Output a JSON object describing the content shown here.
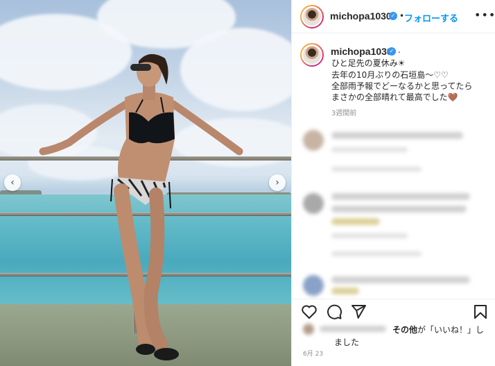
{
  "post": {
    "username": "michopa1030",
    "follow_label": "フォローする",
    "separator": "•",
    "more_label": "•••"
  },
  "caption": {
    "username": "michopa1030",
    "suffix": ".",
    "lines": [
      "ひと足先の夏休み☀︎",
      "去年の10月ぶりの石垣島〜♡♡",
      "全部雨予報でどーなるかと思ってたら",
      "まさかの全部晴れて最高でした🤎"
    ],
    "time_ago": "3週間前"
  },
  "likes": {
    "prefix": "その他",
    "middle": "が「いいね！」し",
    "line2": "ました"
  },
  "date": "6月 23",
  "icons": {
    "like": "heart-icon",
    "comment": "comment-icon",
    "share": "paper-plane-icon",
    "save": "bookmark-icon",
    "verified": "verified-badge-icon",
    "more": "ellipsis-icon",
    "prev": "chevron-left-icon",
    "next": "chevron-right-icon"
  },
  "colors": {
    "follow": "#0095f6",
    "verified": "#3797f0",
    "secondary_text": "#8e8e8e"
  },
  "carousel": {
    "prev_label": "‹",
    "next_label": "›"
  }
}
